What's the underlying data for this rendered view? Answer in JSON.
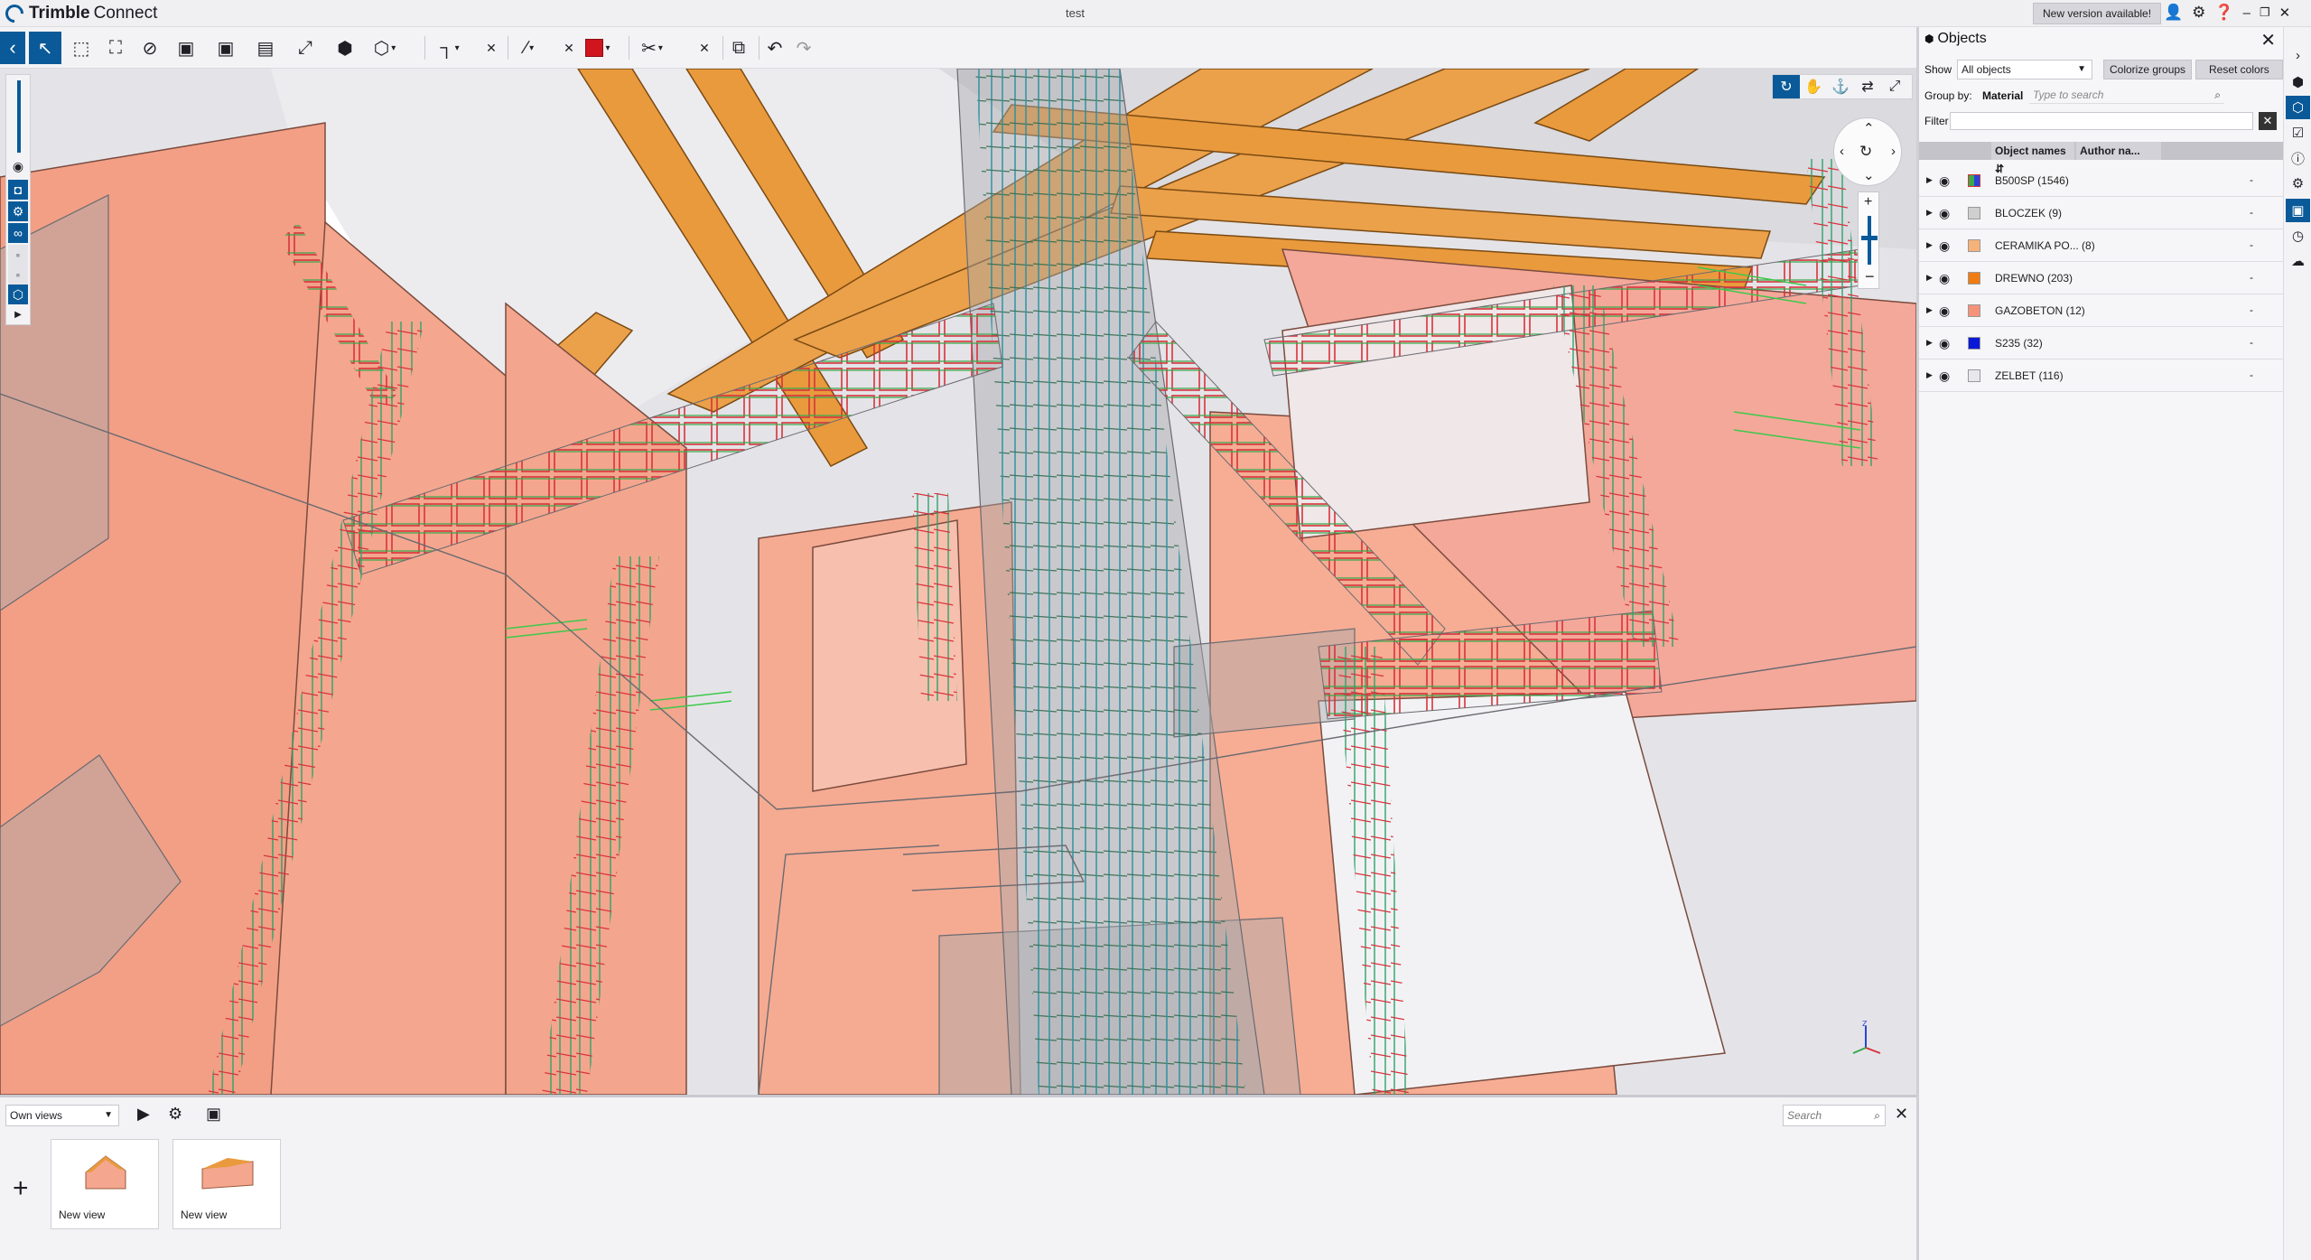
{
  "app": {
    "brand_bold": "Trimble",
    "brand_rest": "Connect",
    "document_title": "test",
    "new_version_label": "New version available!"
  },
  "toolbar": {
    "icons": [
      "back-icon",
      "select-icon",
      "box-select-icon",
      "fit-icon",
      "hide-icon",
      "isolate-icon",
      "section-box-icon",
      "section-plane-icon",
      "fullscreen-icon",
      "object-icon",
      "cube-view-icon",
      "measure-icon",
      "clear-icon",
      "markup-line-icon",
      "clear-icon",
      "color-swatch",
      "clip-icon",
      "clear-icon",
      "visibility-filter-icon",
      "undo-icon",
      "redo-icon"
    ],
    "markup_color": "#d0151d"
  },
  "views": {
    "dropdown_value": "Own views",
    "search_placeholder": "Search",
    "items": [
      {
        "label": "New view"
      },
      {
        "label": "New view"
      }
    ]
  },
  "objects_panel": {
    "title": "Objects",
    "show_label": "Show",
    "show_value": "All objects",
    "colorize_label": "Colorize groups",
    "reset_label": "Reset colors",
    "groupby_label": "Group by:",
    "groupby_value": "Material",
    "groupby_placeholder": "Type to search",
    "filter_label": "Filter",
    "columns": [
      "Object names",
      "Author na..."
    ],
    "rows": [
      {
        "name": "B500SP (1546)",
        "author": "-",
        "swatch": "multi"
      },
      {
        "name": "BLOCZEK (9)",
        "author": "-",
        "swatch": "#cfcfcf"
      },
      {
        "name": "CERAMIKA PO... (8)",
        "author": "-",
        "swatch": "#f7b27a"
      },
      {
        "name": "DREWNO (203)",
        "author": "-",
        "swatch": "#f07b12"
      },
      {
        "name": "GAZOBETON (12)",
        "author": "-",
        "swatch": "#f4927a"
      },
      {
        "name": "S235 (32)",
        "author": "-",
        "swatch": "#0a19d8"
      },
      {
        "name": "ZELBET (116)",
        "author": "-",
        "swatch": "#e8e8ec"
      }
    ]
  },
  "colors": {
    "accent": "#0a5a99",
    "wall": "#f4a78e",
    "timber": "#e99a3d",
    "rebar_red": "#d8323c",
    "rebar_green": "#39c13f"
  }
}
